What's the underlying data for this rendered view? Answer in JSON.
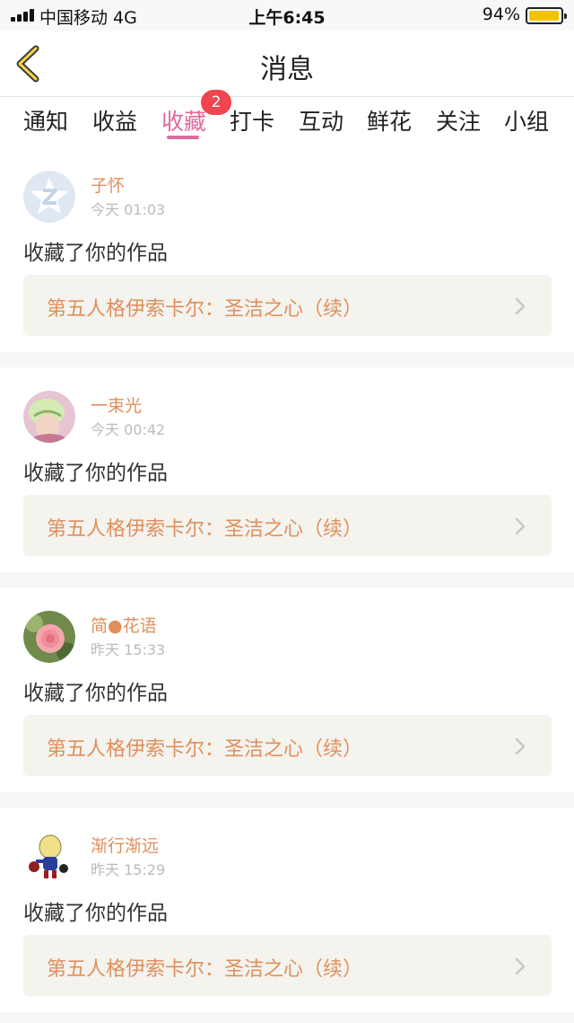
{
  "status": {
    "carrier": "中国移动  4G",
    "time": "上午6:45",
    "battery": "94%",
    "battery_level": 0.94
  },
  "nav": {
    "title": "消息",
    "back_icon": "chevron-left-icon"
  },
  "tabs": [
    {
      "label": "通知"
    },
    {
      "label": "收益"
    },
    {
      "label": "收藏",
      "active": true,
      "badge": "2"
    },
    {
      "label": "打卡"
    },
    {
      "label": "互动"
    },
    {
      "label": "鲜花"
    },
    {
      "label": "关注"
    },
    {
      "label": "小组"
    }
  ],
  "colors": {
    "accent": "#e0699e",
    "badge": "#f0444f",
    "username": "#e08f5b",
    "work_bg": "#f4f3ee"
  },
  "messages": [
    {
      "user": "子怀",
      "time": "今天 01:03",
      "action": "收藏了你的作品",
      "work": "第五人格伊索卡尔：圣洁之心（续）"
    },
    {
      "user": "一束光",
      "time": "今天 00:42",
      "action": "收藏了你的作品",
      "work": "第五人格伊索卡尔：圣洁之心（续）"
    },
    {
      "user": "简●花语",
      "time": "昨天 15:33",
      "action": "收藏了你的作品",
      "work": "第五人格伊索卡尔：圣洁之心（续）"
    },
    {
      "user": "渐行渐远",
      "time": "昨天 15:29",
      "action": "收藏了你的作品",
      "work": "第五人格伊索卡尔：圣洁之心（续）"
    }
  ]
}
